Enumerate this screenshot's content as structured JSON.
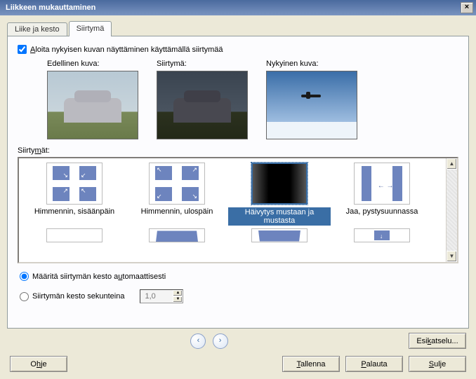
{
  "title": "Liikkeen mukauttaminen",
  "tabs": {
    "movement": "Liike ja kesto",
    "transition": "Siirtymä"
  },
  "checkbox_start": "Aloita nykyisen kuvan näyttäminen käyttämällä siirtymää",
  "underline_a": "A",
  "previews": {
    "prev": "Edellinen kuva:",
    "trans": "Siirtymä:",
    "curr": "Nykyinen kuva:"
  },
  "transitions_label_pre": "Siirty",
  "transitions_label_u": "m",
  "transitions_label_post": "ät:",
  "gallery": {
    "dim_in": "Himmennin, sisäänpäin",
    "dim_out": "Himmennin, ulospäin",
    "fade_black": "Häivytys mustaan ja mustasta",
    "split_v": "Jaa, pystysuunnassa"
  },
  "radio_auto_pre": "Määritä siirtymän kesto a",
  "radio_auto_u": "u",
  "radio_auto_post": "tomaattisesti",
  "radio_seconds": "Siirtymän kesto sekunteina",
  "seconds_value": "1,0",
  "buttons": {
    "preview_pre": "Esi",
    "preview_u": "k",
    "preview_post": "atselu...",
    "help_pre": "O",
    "help_u": "h",
    "help_post": "je",
    "save_u": "T",
    "save_post": "allenna",
    "reset_u": "P",
    "reset_post": "alauta",
    "close_u": "S",
    "close_post": "ulje"
  }
}
